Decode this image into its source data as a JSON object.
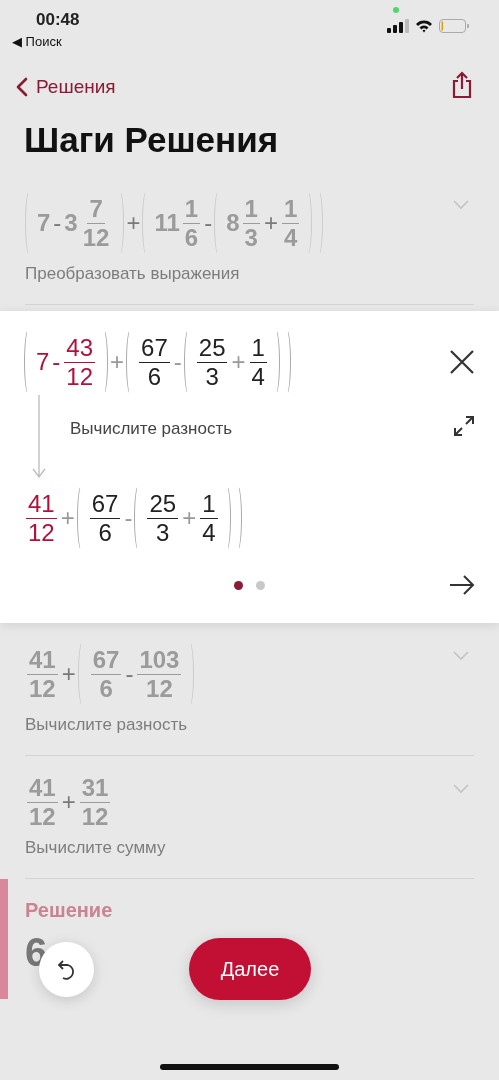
{
  "status_bar": {
    "time": "00:48",
    "back_app": "◀ Поиск"
  },
  "nav": {
    "back": "Решения"
  },
  "title": "Шаги Решения",
  "steps": [
    {
      "expanded": false,
      "label": "Преобразовать выражения",
      "expr": [
        {
          "kind": "paren",
          "children": [
            {
              "kind": "num",
              "text": "7"
            },
            {
              "kind": "op",
              "text": "-"
            },
            {
              "kind": "num",
              "text": "3"
            },
            {
              "kind": "frac",
              "num": "7",
              "den": "12"
            }
          ]
        },
        {
          "kind": "op",
          "text": "+"
        },
        {
          "kind": "paren",
          "children": [
            {
              "kind": "num",
              "text": "11"
            },
            {
              "kind": "frac",
              "num": "1",
              "den": "6"
            },
            {
              "kind": "op",
              "text": "-"
            },
            {
              "kind": "paren",
              "children": [
                {
                  "kind": "num",
                  "text": "8"
                },
                {
                  "kind": "frac",
                  "num": "1",
                  "den": "3"
                },
                {
                  "kind": "op",
                  "text": "+"
                },
                {
                  "kind": "frac",
                  "num": "1",
                  "den": "4"
                }
              ]
            }
          ]
        }
      ]
    },
    {
      "expanded": true,
      "label": "Вычислите разность",
      "expr": [
        {
          "kind": "paren",
          "children": [
            {
              "kind": "num",
              "text": "7",
              "highlight": true
            },
            {
              "kind": "op",
              "text": "-",
              "highlight": true
            },
            {
              "kind": "frac",
              "num": "43",
              "den": "12",
              "highlight": true
            }
          ]
        },
        {
          "kind": "op",
          "text": "+"
        },
        {
          "kind": "paren",
          "children": [
            {
              "kind": "frac",
              "num": "67",
              "den": "6"
            },
            {
              "kind": "op",
              "text": "-"
            },
            {
              "kind": "paren",
              "children": [
                {
                  "kind": "frac",
                  "num": "25",
                  "den": "3"
                },
                {
                  "kind": "op",
                  "text": "+"
                },
                {
                  "kind": "frac",
                  "num": "1",
                  "den": "4"
                }
              ]
            }
          ]
        }
      ],
      "result": [
        {
          "kind": "frac",
          "num": "41",
          "den": "12",
          "highlight": true
        },
        {
          "kind": "op",
          "text": "+"
        },
        {
          "kind": "paren",
          "children": [
            {
              "kind": "frac",
              "num": "67",
              "den": "6"
            },
            {
              "kind": "op",
              "text": "-"
            },
            {
              "kind": "paren",
              "children": [
                {
                  "kind": "frac",
                  "num": "25",
                  "den": "3"
                },
                {
                  "kind": "op",
                  "text": "+"
                },
                {
                  "kind": "frac",
                  "num": "1",
                  "den": "4"
                }
              ]
            }
          ]
        }
      ],
      "pages": [
        {
          "selected": true
        },
        {
          "selected": false
        }
      ]
    },
    {
      "expanded": false,
      "label": "Вычислите разность",
      "expr": [
        {
          "kind": "frac",
          "num": "41",
          "den": "12"
        },
        {
          "kind": "op",
          "text": "+"
        },
        {
          "kind": "paren",
          "children": [
            {
              "kind": "frac",
              "num": "67",
              "den": "6"
            },
            {
              "kind": "op",
              "text": "-"
            },
            {
              "kind": "frac",
              "num": "103",
              "den": "12"
            }
          ]
        }
      ]
    },
    {
      "expanded": false,
      "label": "Вычислите сумму",
      "expr": [
        {
          "kind": "frac",
          "num": "41",
          "den": "12"
        },
        {
          "kind": "op",
          "text": "+"
        },
        {
          "kind": "frac",
          "num": "31",
          "den": "12"
        }
      ]
    }
  ],
  "solution": {
    "heading": "Решение",
    "value": "6"
  },
  "next_button": "Далее"
}
